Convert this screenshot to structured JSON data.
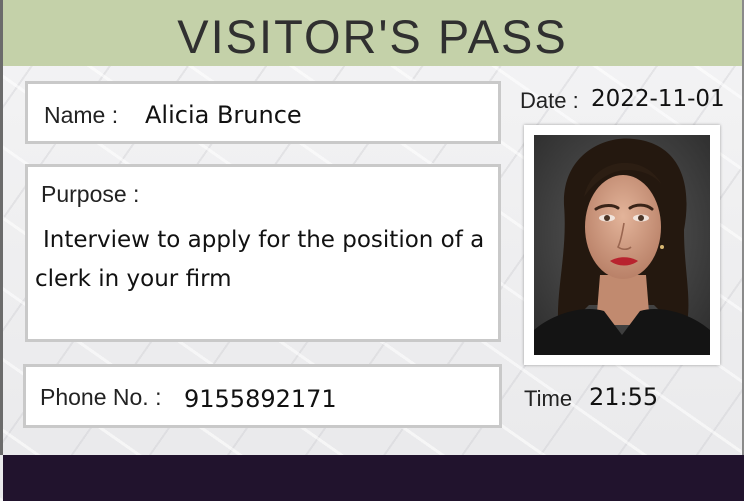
{
  "header": {
    "title": "VISITOR'S PASS"
  },
  "name": {
    "label": "Name :",
    "value": "Alicia Brunce"
  },
  "purpose": {
    "label": "Purpose :",
    "value": "Interview to apply for the position of a clerk in your firm"
  },
  "phone": {
    "label": "Phone No. :",
    "value": "9155892171"
  },
  "date": {
    "label": "Date :",
    "value": "2022-11-01"
  },
  "time": {
    "label": "Time",
    "value": "21:55"
  },
  "colors": {
    "header_bg": "#c4d1a9",
    "footer_bg": "#21132d",
    "field_border": "#c9c9c9"
  }
}
